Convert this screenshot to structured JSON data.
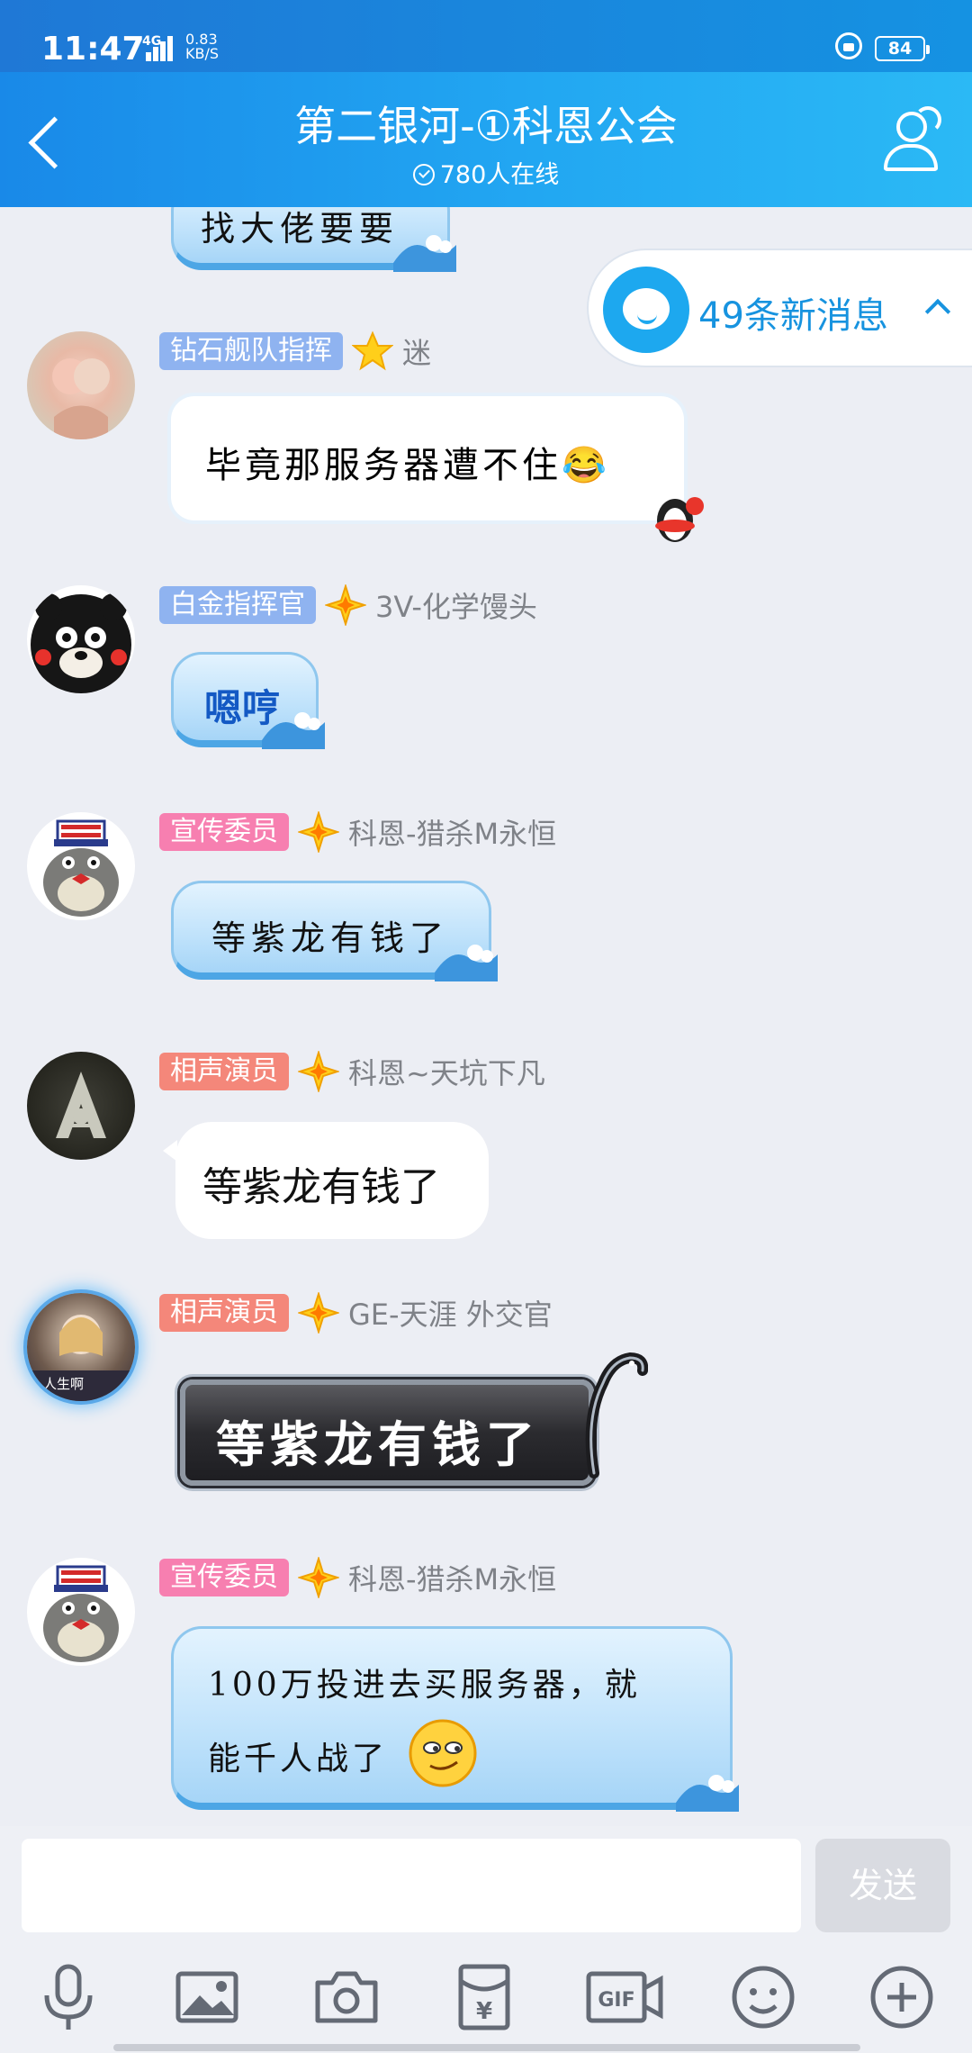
{
  "status": {
    "time": "11:47",
    "network": "4G",
    "speed_value": "0.83",
    "speed_unit": "KB/S",
    "battery": "84"
  },
  "header": {
    "title": "第二银河-①科恩公会",
    "online": "780人在线"
  },
  "new_messages": {
    "label": "49条新消息"
  },
  "partial_message": {
    "text": "找大佬要要"
  },
  "messages": [
    {
      "badge": "钻石舰队指挥",
      "badge_color": "#8fb3f0",
      "nick": "迷",
      "text": "毕竟那服务器遭不住😂"
    },
    {
      "badge": "白金指挥官",
      "badge_color": "#8fb3f0",
      "nick": "3V-化学馒头",
      "text": "嗯哼"
    },
    {
      "badge": "宣传委员",
      "badge_color": "#f77fb0",
      "nick": "科恩-猎杀M永恒",
      "text": "等紫龙有钱了"
    },
    {
      "badge": "相声演员",
      "badge_color": "#f4877a",
      "nick": "科恩~天坑下凡",
      "text": "等紫龙有钱了"
    },
    {
      "badge": "相声演员",
      "badge_color": "#f4877a",
      "nick": "GE-天涯  外交官",
      "text": "等紫龙有钱了",
      "avatar_caption": "人生啊"
    },
    {
      "badge": "宣传委员",
      "badge_color": "#f77fb0",
      "nick": "科恩-猎杀M永恒",
      "text_line1": "100万投进去买服务器，就",
      "text_line2": "能千人战了"
    }
  ],
  "input": {
    "placeholder": "",
    "send_label": "发送"
  },
  "toolbar": [
    "mic-icon",
    "image-icon",
    "camera-icon",
    "red-packet-icon",
    "gif-icon",
    "emoji-icon",
    "plus-icon"
  ]
}
